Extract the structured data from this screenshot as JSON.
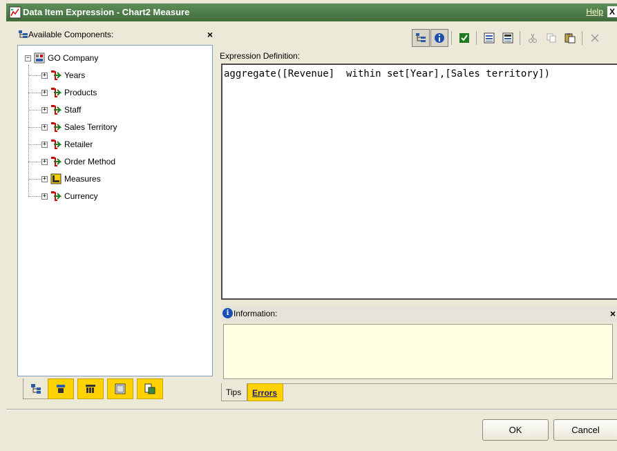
{
  "window": {
    "title": "Data Item Expression - Chart2 Measure",
    "help_label": "Help",
    "close_label": "X"
  },
  "left_panel": {
    "header": "Available Components:",
    "close_label": "×",
    "tree": {
      "root": {
        "label": "GO Company",
        "icon": "package-icon",
        "expanded": true
      },
      "children": [
        {
          "label": "Years",
          "icon": "dimension-icon"
        },
        {
          "label": "Products",
          "icon": "dimension-icon"
        },
        {
          "label": "Staff",
          "icon": "dimension-icon"
        },
        {
          "label": "Sales Territory",
          "icon": "dimension-icon"
        },
        {
          "label": "Retailer",
          "icon": "dimension-icon"
        },
        {
          "label": "Order Method",
          "icon": "dimension-icon"
        },
        {
          "label": "Measures",
          "icon": "measure-dimension-icon"
        },
        {
          "label": "Currency",
          "icon": "dimension-icon"
        }
      ]
    },
    "tabs": [
      {
        "name": "source-tab",
        "icon": "source-icon",
        "active": true
      },
      {
        "name": "data-items-tab",
        "icon": "data-items-icon"
      },
      {
        "name": "query-items-tab",
        "icon": "query-items-icon"
      },
      {
        "name": "functions-tab",
        "icon": "functions-icon"
      },
      {
        "name": "parameters-tab",
        "icon": "parameters-icon"
      }
    ]
  },
  "toolbar": {
    "buttons": [
      {
        "name": "tree-view-button",
        "icon": "tree-view-icon",
        "pressed": true
      },
      {
        "name": "information-button",
        "icon": "information-icon",
        "pressed": true
      },
      {
        "name": "validate-button",
        "icon": "check-icon"
      },
      {
        "name": "view-button-1",
        "icon": "list-view-icon"
      },
      {
        "name": "view-button-2",
        "icon": "list-view-icon"
      },
      {
        "name": "cut-button",
        "icon": "scissors-icon"
      },
      {
        "name": "copy-button",
        "icon": "copy-icon"
      },
      {
        "name": "paste-button",
        "icon": "paste-icon"
      },
      {
        "name": "delete-button",
        "icon": "delete-icon"
      }
    ]
  },
  "expression": {
    "label": "Expression Definition:",
    "value": "aggregate([Revenue]  within set[Year],[Sales territory])"
  },
  "information": {
    "label": "Information:",
    "close_label": "×",
    "content": ""
  },
  "bottom_tabs": {
    "tips": "Tips",
    "errors": "Errors"
  },
  "buttons": {
    "ok": "OK",
    "cancel": "Cancel"
  },
  "colors": {
    "title_bar": "#4f7d4a",
    "accent_yellow": "#ffd200",
    "info_background": "#ffffe1"
  }
}
